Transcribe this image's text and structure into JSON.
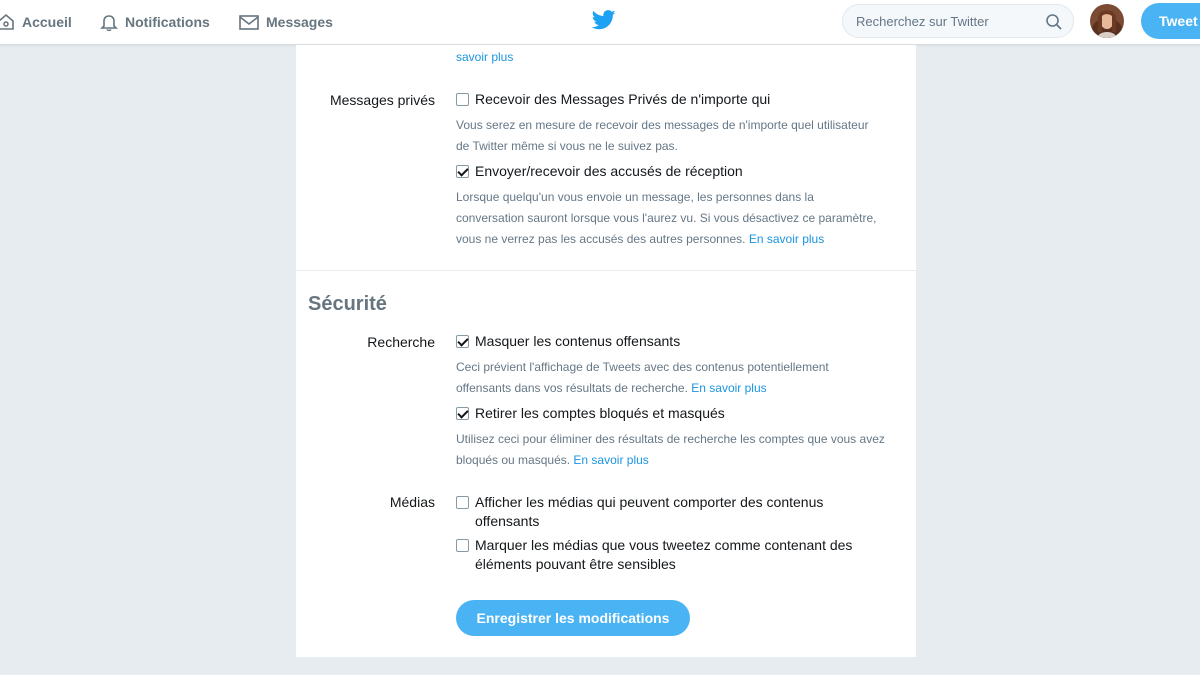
{
  "nav": {
    "home_label": "Accueil",
    "notifications_label": "Notifications",
    "messages_label": "Messages",
    "search_placeholder": "Recherchez sur Twitter",
    "tweet_button": "Tweet"
  },
  "colors": {
    "accent": "#1da1f2",
    "button": "#4ab3f4",
    "link": "#1b95e0",
    "background": "#e6ecf0"
  },
  "top_link": "savoir plus",
  "dm": {
    "label": "Messages privés",
    "option1": {
      "label": "Recevoir des Messages Privés de n'importe qui",
      "checked": false,
      "help_line1": "Vous serez en mesure de recevoir des messages de n'importe quel utilisateur",
      "help_line2": "de Twitter même si vous ne le suivez pas."
    },
    "option2": {
      "label": "Envoyer/recevoir des accusés de réception",
      "checked": true,
      "help_line1": "Lorsque quelqu'un vous envoie un message, les personnes dans la",
      "help_line2": "conversation sauront lorsque vous l'aurez vu. Si vous désactivez ce paramètre,",
      "help_line3": "vous ne verrez pas les accusés des autres personnes.",
      "link": "En savoir plus"
    }
  },
  "security": {
    "title": "Sécurité",
    "search": {
      "label": "Recherche",
      "option1": {
        "label": "Masquer les contenus offensants",
        "checked": true,
        "help_line1": "Ceci prévient l'affichage de Tweets avec des contenus potentiellement",
        "help_line2": "offensants dans vos résultats de recherche.",
        "link": "En savoir plus"
      },
      "option2": {
        "label": "Retirer les comptes bloqués et masqués",
        "checked": true,
        "help_line1": "Utilisez ceci pour éliminer des résultats de recherche les comptes que vous avez",
        "help_line2": "bloqués ou masqués.",
        "link": "En savoir plus"
      }
    },
    "media": {
      "label": "Médias",
      "option1": {
        "label_line1": "Afficher les médias qui peuvent comporter des contenus",
        "label_line2": "offensants",
        "checked": false
      },
      "option2": {
        "label_line1": "Marquer les médias que vous tweetez comme contenant des",
        "label_line2": "éléments pouvant être sensibles",
        "checked": false
      }
    }
  },
  "save_button": "Enregistrer les modifications"
}
